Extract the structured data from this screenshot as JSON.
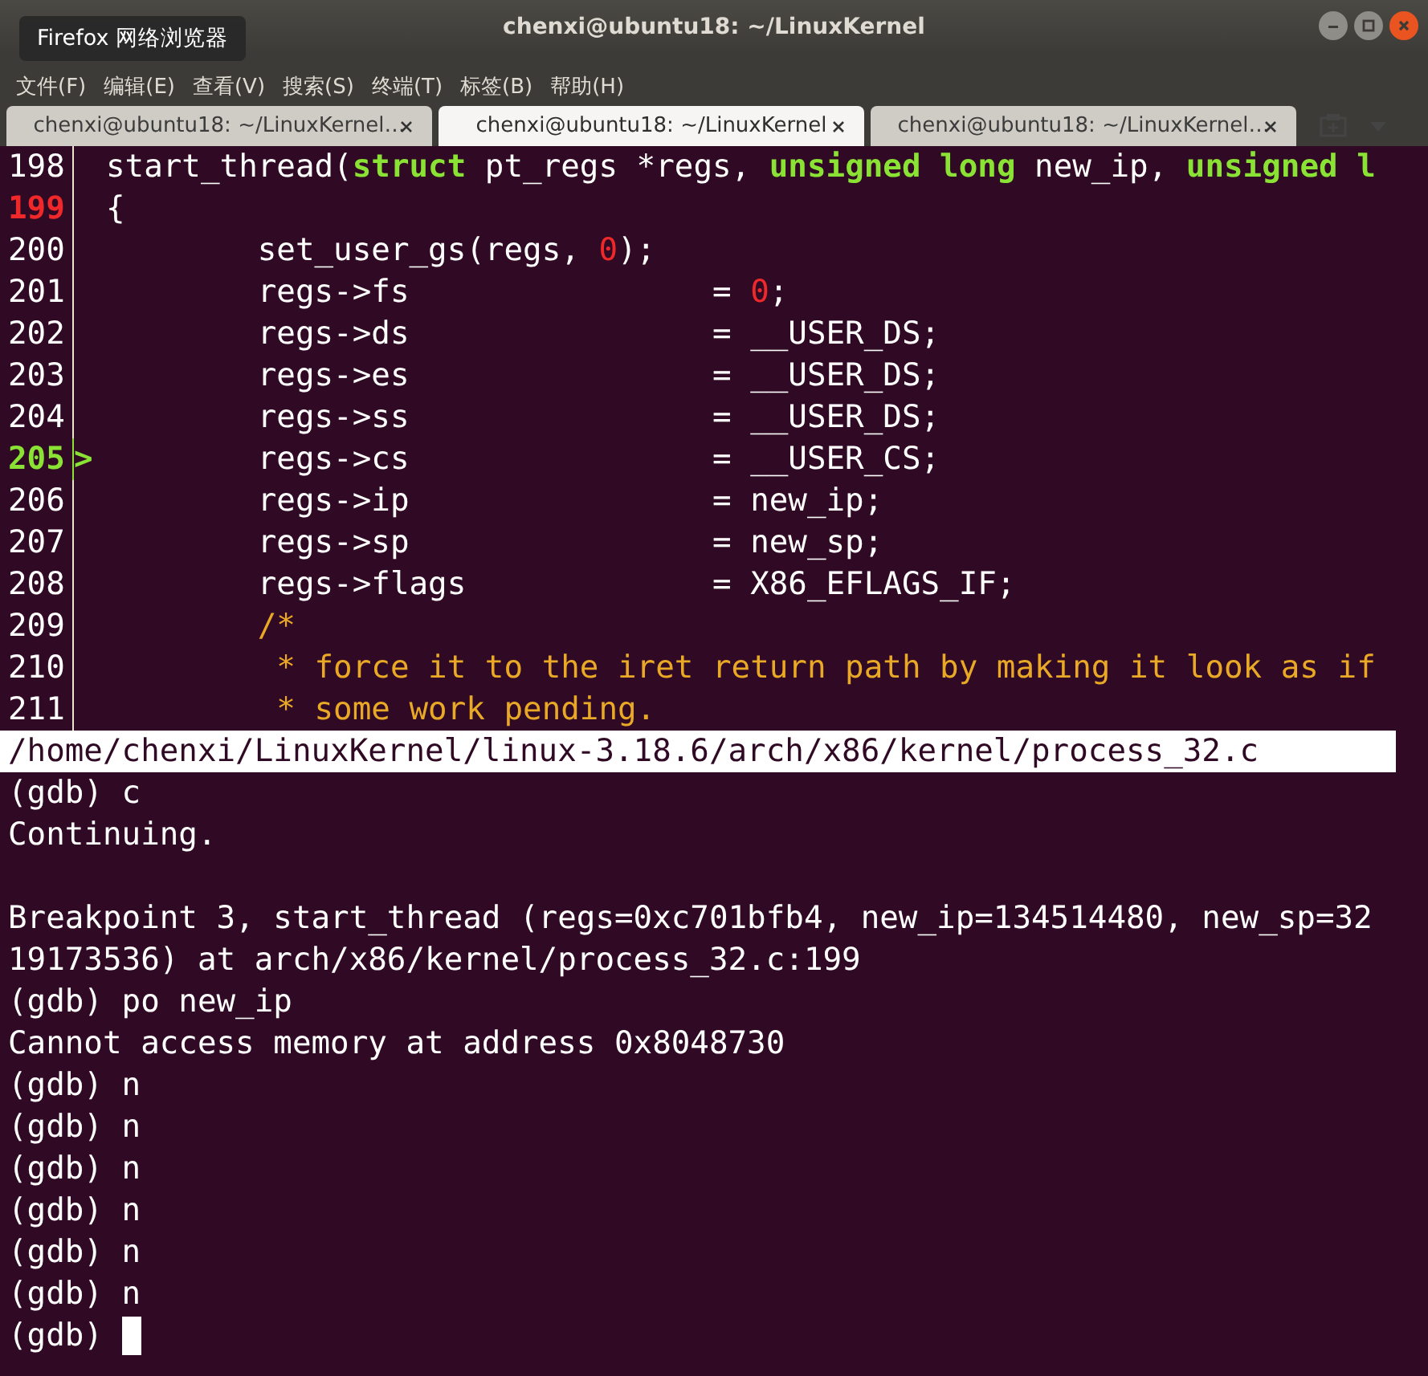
{
  "window": {
    "title": "chenxi@ubuntu18: ~/LinuxKernel"
  },
  "tooltip": {
    "text": "Firefox 网络浏览器"
  },
  "menu": [
    "文件(F)",
    "编辑(E)",
    "查看(V)",
    "搜索(S)",
    "终端(T)",
    "标签(B)",
    "帮助(H)"
  ],
  "tabs": [
    {
      "label": "chenxi@ubuntu18: ~/LinuxKernel…",
      "selected": false
    },
    {
      "label": "chenxi@ubuntu18: ~/LinuxKernel",
      "selected": true
    },
    {
      "label": "chenxi@ubuntu18: ~/LinuxKernel…",
      "selected": false
    }
  ],
  "source": {
    "lines": [
      {
        "number": "198",
        "breakpoint": false,
        "current": false,
        "segments": [
          {
            "kind": "plain",
            "text": "start_thread("
          },
          {
            "kind": "keyword",
            "text": "struct"
          },
          {
            "kind": "plain",
            "text": " pt_regs *regs, "
          },
          {
            "kind": "keyword",
            "text": "unsigned long"
          },
          {
            "kind": "plain",
            "text": " new_ip, "
          },
          {
            "kind": "keyword",
            "text": "unsigned l"
          }
        ]
      },
      {
        "number": "199",
        "breakpoint": true,
        "current": false,
        "segments": [
          {
            "kind": "plain",
            "text": "{"
          }
        ]
      },
      {
        "number": "200",
        "breakpoint": false,
        "current": false,
        "segments": [
          {
            "kind": "plain",
            "text": "        set_user_gs(regs, "
          },
          {
            "kind": "number",
            "text": "0"
          },
          {
            "kind": "plain",
            "text": ");"
          }
        ]
      },
      {
        "number": "201",
        "breakpoint": false,
        "current": false,
        "segments": [
          {
            "kind": "plain",
            "text": "        regs->fs                = "
          },
          {
            "kind": "number",
            "text": "0"
          },
          {
            "kind": "plain",
            "text": ";"
          }
        ]
      },
      {
        "number": "202",
        "breakpoint": false,
        "current": false,
        "segments": [
          {
            "kind": "plain",
            "text": "        regs->ds                = __USER_DS;"
          }
        ]
      },
      {
        "number": "203",
        "breakpoint": false,
        "current": false,
        "segments": [
          {
            "kind": "plain",
            "text": "        regs->es                = __USER_DS;"
          }
        ]
      },
      {
        "number": "204",
        "breakpoint": false,
        "current": false,
        "segments": [
          {
            "kind": "plain",
            "text": "        regs->ss                = __USER_DS;"
          }
        ]
      },
      {
        "number": "205",
        "breakpoint": false,
        "current": true,
        "marker": ">",
        "segments": [
          {
            "kind": "plain",
            "text": "        regs->cs                = __USER_CS;"
          }
        ]
      },
      {
        "number": "206",
        "breakpoint": false,
        "current": false,
        "segments": [
          {
            "kind": "plain",
            "text": "        regs->ip                = new_ip;"
          }
        ]
      },
      {
        "number": "207",
        "breakpoint": false,
        "current": false,
        "segments": [
          {
            "kind": "plain",
            "text": "        regs->sp                = new_sp;"
          }
        ]
      },
      {
        "number": "208",
        "breakpoint": false,
        "current": false,
        "segments": [
          {
            "kind": "plain",
            "text": "        regs->flags             = X86_EFLAGS_IF;"
          }
        ]
      },
      {
        "number": "209",
        "breakpoint": false,
        "current": false,
        "segments": [
          {
            "kind": "comment",
            "text": "        /*"
          }
        ]
      },
      {
        "number": "210",
        "breakpoint": false,
        "current": false,
        "segments": [
          {
            "kind": "comment",
            "text": "         * force it to the iret return path by making it look as if"
          }
        ]
      },
      {
        "number": "211",
        "breakpoint": false,
        "current": false,
        "segments": [
          {
            "kind": "comment",
            "text": "         * some work pending."
          }
        ]
      }
    ]
  },
  "status_bar": "/home/chenxi/LinuxKernel/linux-3.18.6/arch/x86/kernel/process_32.c",
  "console_paragraphs": [
    [
      "(gdb) c",
      "Continuing."
    ],
    [
      "Breakpoint 3, start_thread (regs=0xc701bfb4, new_ip=134514480, new_sp=32",
      "19173536) at arch/x86/kernel/process_32.c:199",
      "(gdb) po new_ip",
      "Cannot access memory at address 0x8048730",
      "(gdb) n",
      "(gdb) n",
      "(gdb) n",
      "(gdb) n",
      "(gdb) n",
      "(gdb) n"
    ]
  ],
  "prompt": "(gdb) "
}
